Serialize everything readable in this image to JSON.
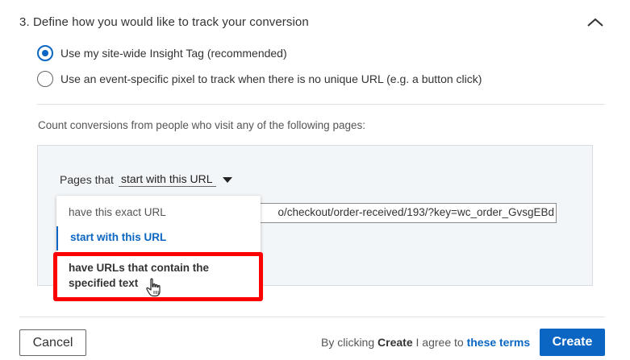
{
  "section": {
    "title": "3. Define how you would like to track your conversion"
  },
  "options": {
    "insight_tag": "Use my site-wide Insight Tag (recommended)",
    "event_pixel": "Use an event-specific pixel to track when there is no unique URL (e.g. a button click)",
    "selected": "insight_tag"
  },
  "count_text": "Count conversions from people who visit any of the following pages:",
  "rule": {
    "prefix": "Pages that",
    "selected_label": "start with this URL",
    "url_value": "o/checkout/order-received/193/?key=wc_order_GvsgEBd"
  },
  "dropdown": {
    "items": [
      "have this exact URL",
      "start with this URL",
      "have URLs that contain the specified text"
    ],
    "active_index": 1,
    "hovered_index": 2
  },
  "footer": {
    "cancel_label": "Cancel",
    "agree_prefix": "By clicking",
    "agree_bold": "Create",
    "agree_middle": "I agree to",
    "terms_link": "these terms",
    "create_label": "Create"
  },
  "colors": {
    "accent": "#0a66c2",
    "highlight": "#ff0000",
    "panel_bg": "#f3f6f8"
  }
}
